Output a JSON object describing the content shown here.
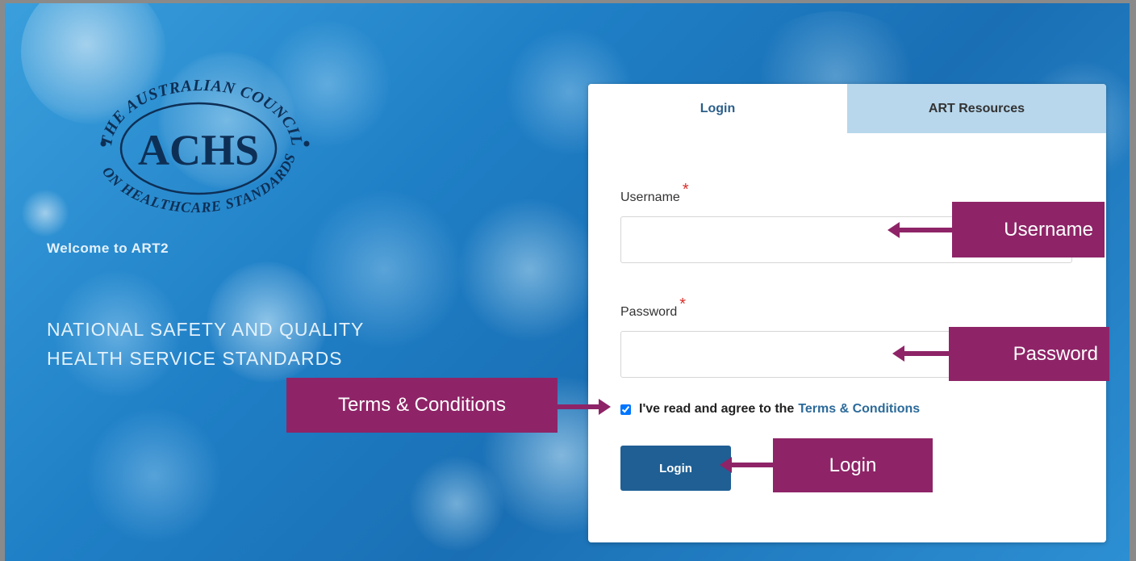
{
  "brand": {
    "logo_top_text": "THE AUSTRALIAN COUNCIL",
    "logo_acronym": "ACHS",
    "logo_bottom_text": "ON HEALTHCARE STANDARDS"
  },
  "hero": {
    "welcome": "Welcome to ART2",
    "standards_line1": "NATIONAL SAFETY AND QUALITY",
    "standards_line2": "HEALTH SERVICE STANDARDS"
  },
  "login_panel": {
    "tabs": [
      {
        "label": "Login",
        "active": true
      },
      {
        "label": "ART Resources",
        "active": false
      }
    ],
    "username_label": "Username",
    "username_value": "",
    "password_label": "Password",
    "password_value": "",
    "required_marker": "*",
    "terms_text": "I've read and agree to the",
    "terms_link": "Terms & Conditions",
    "terms_checked": true,
    "login_button": "Login"
  },
  "annotations": {
    "username": "Username",
    "password": "Password",
    "terms": "Terms & Conditions",
    "login": "Login"
  },
  "colors": {
    "callout": "#8e2467",
    "button": "#1f5f94",
    "link": "#2b6a9a",
    "required": "#d9302c",
    "inactive_tab": "#b8d7ec"
  }
}
